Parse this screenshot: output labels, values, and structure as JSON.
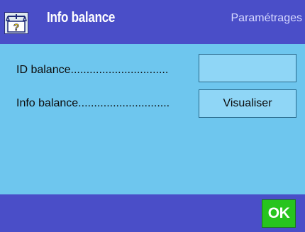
{
  "header": {
    "title": "Info balance",
    "context": "Paramétrages",
    "icon": "balance-info-icon"
  },
  "rows": [
    {
      "label": "ID balance...............................",
      "button_label": ""
    },
    {
      "label": "Info balance.............................",
      "button_label": "Visualiser"
    }
  ],
  "footer": {
    "ok_label": "OK"
  },
  "colors": {
    "header_bg": "#4a4ec8",
    "content_bg": "#6ec6ee",
    "ok_button": "#27c41e"
  }
}
